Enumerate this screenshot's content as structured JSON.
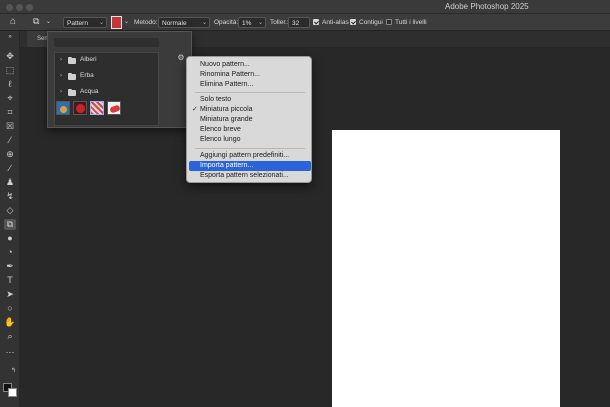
{
  "window": {
    "title": "Adobe Photoshop 2025"
  },
  "options_bar": {
    "fill_source": "Pattern",
    "method_label": "Metodo:",
    "method_value": "Normale",
    "opacity_label": "Opacità:",
    "opacity_value": "1%",
    "tolerance_label": "Toller.:",
    "tolerance_value": "32",
    "antialias_label": "Anti-alias",
    "antialias_checked": true,
    "contiguous_label": "Contigui",
    "contiguous_checked": true,
    "all_layers_label": "Tutti i livelli",
    "all_layers_checked": false
  },
  "document": {
    "tab_label": "Sen"
  },
  "pattern_picker": {
    "folders": [
      {
        "label": "Alberi"
      },
      {
        "label": "Erba"
      },
      {
        "label": "Acqua"
      }
    ],
    "thumbnails": [
      {
        "name": "pattern-thumb-1",
        "color": "#d8a23a"
      },
      {
        "name": "pattern-thumb-2",
        "color": "#c0282c"
      },
      {
        "name": "pattern-thumb-3",
        "color": "#c94b4b"
      },
      {
        "name": "pattern-thumb-4",
        "color": "#d63a3a"
      }
    ]
  },
  "context_menu": {
    "items": [
      {
        "label": "Nuovo pattern..."
      },
      {
        "label": "Rinomina Pattern..."
      },
      {
        "label": "Elimina Pattern..."
      },
      {
        "label": "Solo testo"
      },
      {
        "label": "Miniatura piccola",
        "checked": true
      },
      {
        "label": "Miniatura grande"
      },
      {
        "label": "Elenco breve"
      },
      {
        "label": "Elenco lungo"
      },
      {
        "label": "Aggiungi pattern predefiniti..."
      },
      {
        "label": "Importa pattern...",
        "highlighted": true
      },
      {
        "label": "Esporta pattern selezionati..."
      }
    ]
  },
  "colors": {
    "menu_highlight": "#2b64d9",
    "canvas": "#ffffff",
    "workspace": "#282828"
  }
}
